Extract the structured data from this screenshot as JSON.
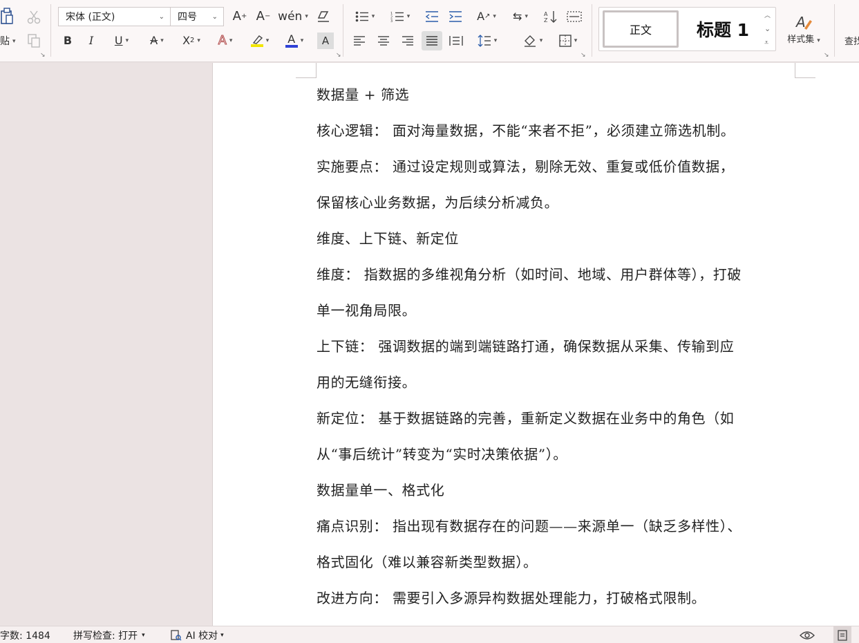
{
  "ribbon": {
    "paste_label": "贴",
    "font_name": "宋体 (正文)",
    "font_size": "四号",
    "styles": {
      "normal": "正文",
      "heading1": "标题 1",
      "gallery_label": "样式集"
    },
    "find_label": "查找",
    "colors": {
      "highlight": "#f2e600",
      "font_color": "#2f41d6"
    }
  },
  "document": {
    "paragraphs": [
      "数据量 + 筛选",
      "核心逻辑： 面对海量数据，不能“来者不拒”，必须建立筛选机制。",
      "实施要点： 通过设定规则或算法，剔除无效、重复或低价值数据，",
      "保留核心业务数据，为后续分析减负。",
      "维度、上下链、新定位",
      "维度： 指数据的多维视角分析（如时间、地域、用户群体等），打破",
      "单一视角局限。",
      "上下链： 强调数据的端到端链路打通，确保数据从采集、传输到应",
      "用的无缝衔接。",
      "新定位： 基于数据链路的完善，重新定义数据在业务中的角色（如",
      "从“事后统计”转变为“实时决策依据”）。",
      "数据量单一、格式化",
      "痛点识别： 指出现有数据存在的问题——来源单一（缺乏多样性）、",
      "格式固化（难以兼容新类型数据）。",
      "改进方向： 需要引入多源异构数据处理能力，打破格式限制。"
    ]
  },
  "status": {
    "word_count": "字数: 1484",
    "spell_check": "拼写检查: 打开",
    "ai_proofread": "AI 校对"
  }
}
